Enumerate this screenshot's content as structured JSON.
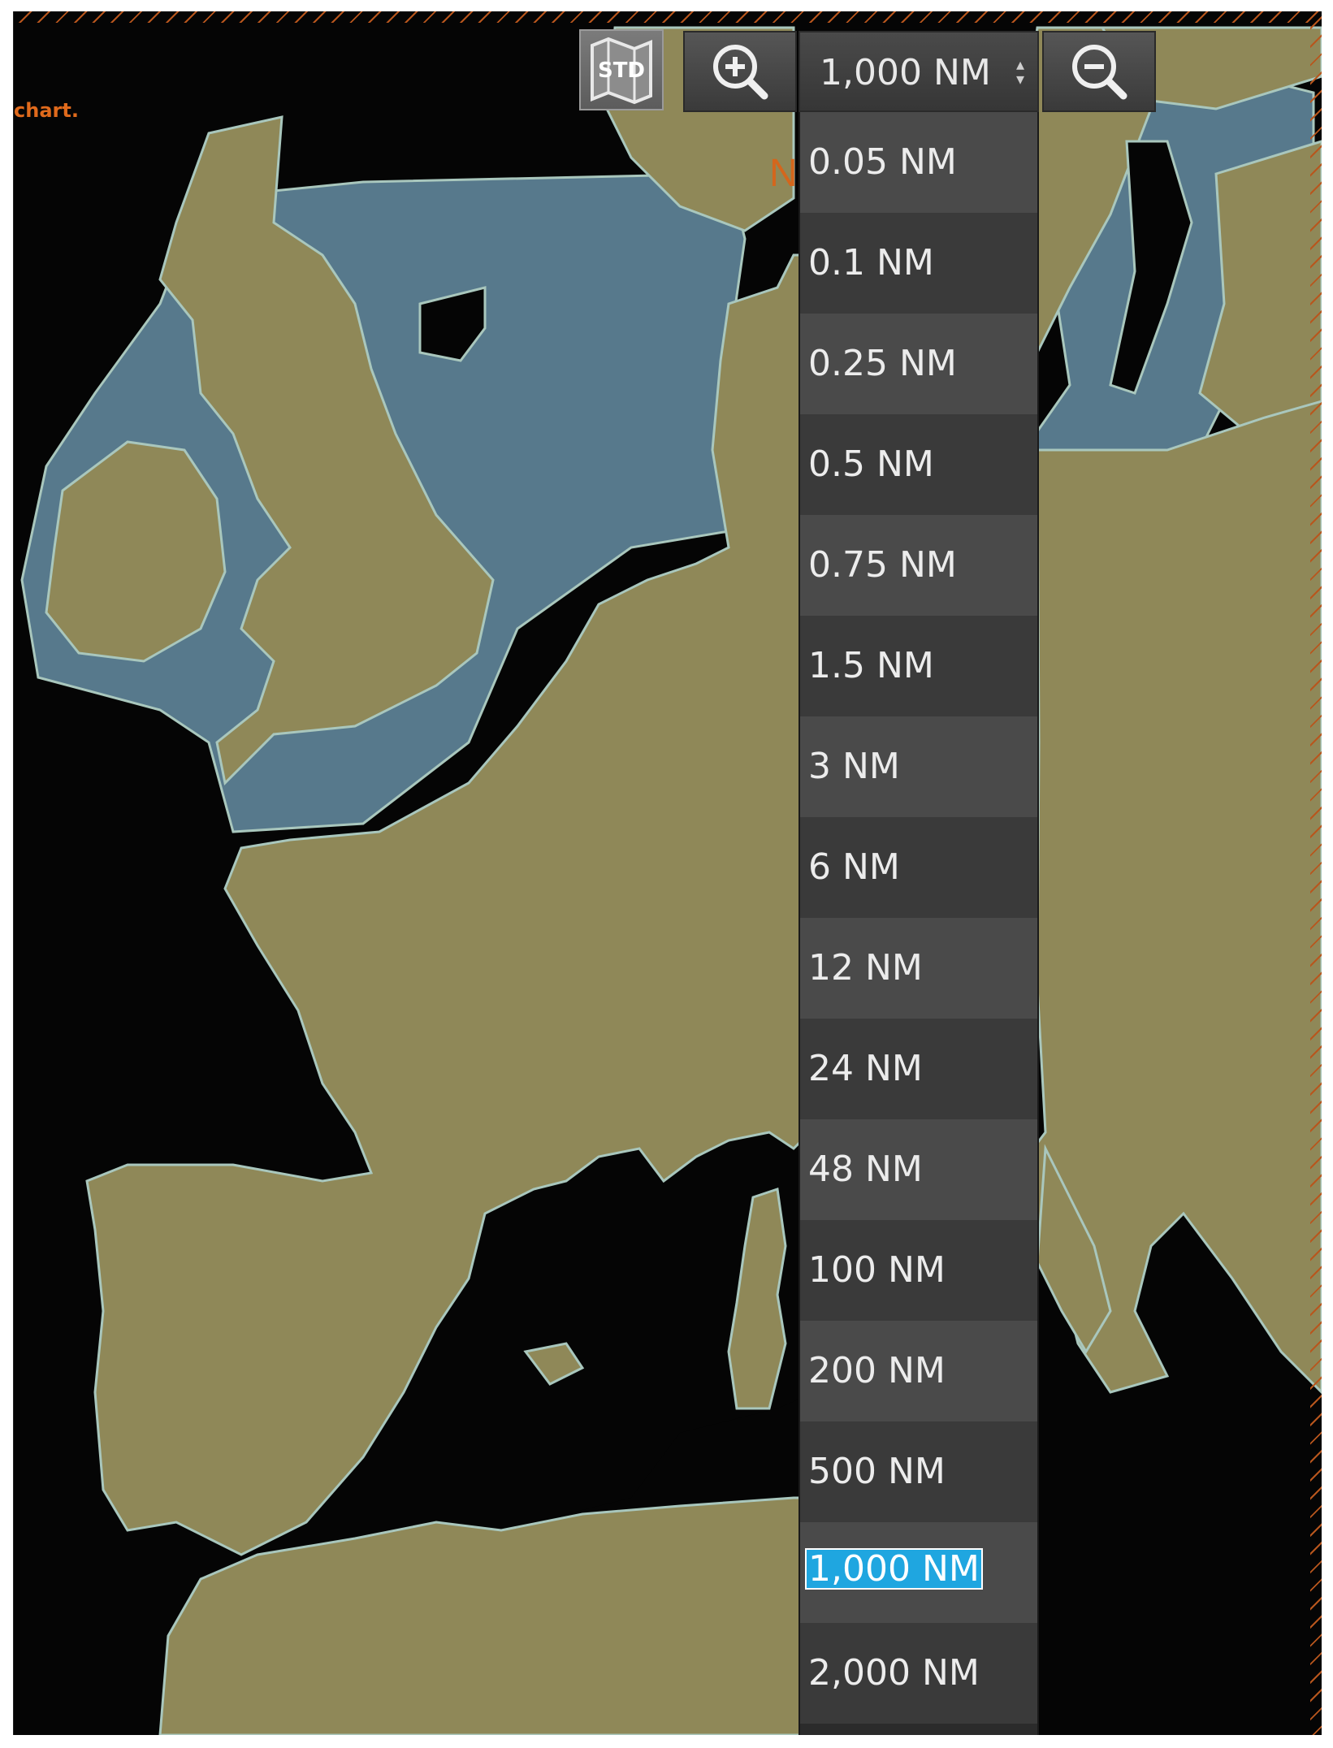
{
  "chart": {
    "partial_message": "chart.",
    "label": "N                         D",
    "colors": {
      "sea_deep": "#050505",
      "sea_shallow": "#57798c",
      "land": "#8f8858",
      "coast": "#a9c7bd",
      "hatch": "#b8561d"
    }
  },
  "toolbar": {
    "std_label": "STD",
    "zoom_in_icon": "zoom-in-icon",
    "zoom_out_icon": "zoom-out-icon",
    "scale_select": {
      "value": "1,000 NM",
      "arrows_icon": "up-down-arrows-icon"
    }
  },
  "scale_options": [
    "0.05 NM",
    "0.1 NM",
    "0.25 NM",
    "0.5 NM",
    "0.75 NM",
    "1.5 NM",
    "3 NM",
    "6 NM",
    "12 NM",
    "24 NM",
    "48 NM",
    "100 NM",
    "200 NM",
    "500 NM",
    "1,000 NM",
    "2,000 NM"
  ],
  "selected_scale": "1,000 NM"
}
